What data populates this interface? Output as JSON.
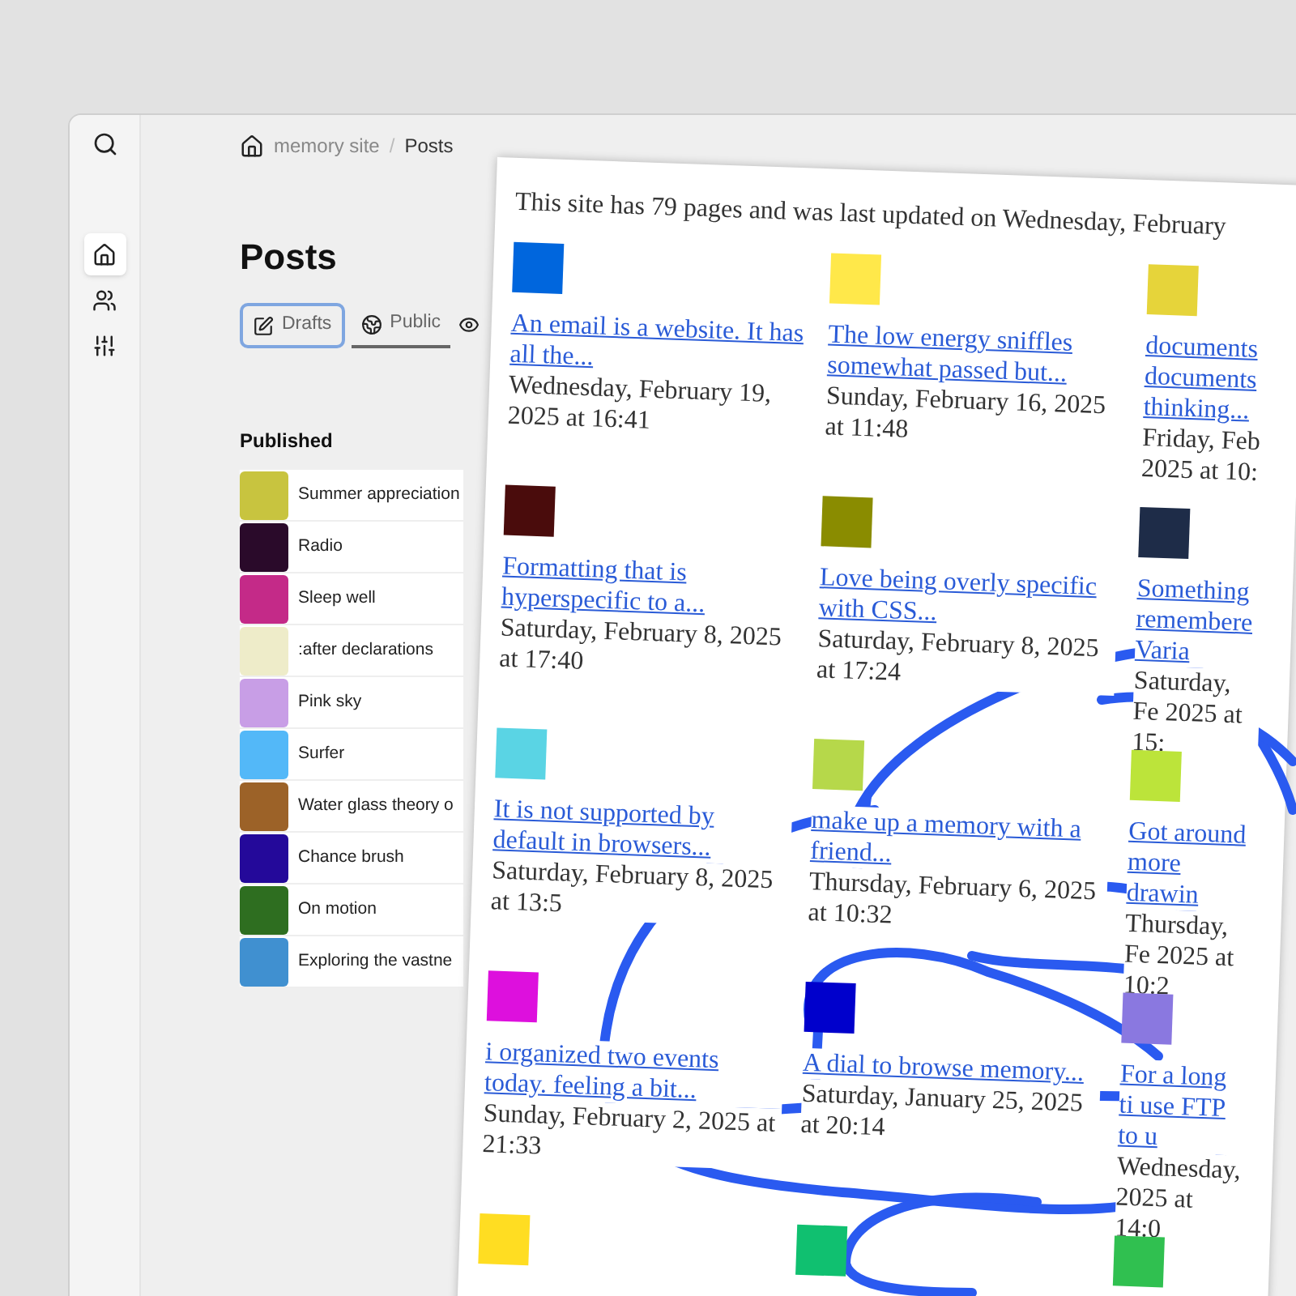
{
  "sidebar": {
    "items": [
      {
        "selected": true
      },
      {
        "selected": false
      },
      {
        "selected": false
      }
    ]
  },
  "breadcrumb": {
    "items": [
      "memory site",
      "Posts"
    ],
    "separator": "/"
  },
  "heading": "Posts",
  "tabs": [
    {
      "label": "Drafts",
      "selected": false,
      "focused": true
    },
    {
      "label": "Public",
      "selected": true,
      "focused": false
    },
    {
      "selected": false,
      "focused": false
    }
  ],
  "published": {
    "title": "Published",
    "items": [
      {
        "title": "Summer appreciation",
        "color": "#c8c43f"
      },
      {
        "title": "Radio",
        "color": "#2a0a2a"
      },
      {
        "title": "Sleep well",
        "color": "#c42a88"
      },
      {
        "title": ":after declarations",
        "color": "#eeecc9"
      },
      {
        "title": "Pink sky",
        "color": "#c89ee6"
      },
      {
        "title": "Surfer",
        "color": "#53b8f8"
      },
      {
        "title": "Water glass theory o",
        "color": "#9c6228"
      },
      {
        "title": "Chance brush",
        "color": "#24099a"
      },
      {
        "title": "On motion",
        "color": "#2e6e20"
      },
      {
        "title": "Exploring the vastne",
        "color": "#4090d0"
      }
    ]
  },
  "preview": {
    "summary": "This site has 79 pages and was last updated on Wednesday, February",
    "cards": [
      {
        "color": "#0066dd",
        "title": "An email is a website. It has all the...",
        "date": "Wednesday, February 19, 2025 at 16:41"
      },
      {
        "color": "#ffe84a",
        "title": "The low energy sniffles somewhat passed but...",
        "date": "Sunday, February 16, 2025 at 11:48"
      },
      {
        "color": "#e6d43a",
        "title": "documents documents thinking...",
        "date": "Friday, Feb 2025 at 10:"
      },
      {
        "color": "#4a0c0c",
        "title": "Formatting that is hyperspecific to a...",
        "date": "Saturday, February 8, 2025 at 17:40"
      },
      {
        "color": "#8a8c00",
        "title": "Love being overly specific with CSS...",
        "date": "Saturday, February 8, 2025 at 17:24"
      },
      {
        "color": "#1e2c48",
        "title": "Something remembere Varia",
        "date": "Saturday, Fe 2025 at 15:"
      },
      {
        "color": "#5ad4e4",
        "title": "It is not supported by default in browsers...",
        "date": "Saturday, February 8, 2025 at 13:5"
      },
      {
        "color": "#b6d84a",
        "title": "make up a memory with a friend...",
        "date": "Thursday, February 6, 2025 at 10:32"
      },
      {
        "color": "#bce43a",
        "title": "Got around more drawin",
        "date": "Thursday, Fe 2025 at 10:2"
      },
      {
        "color": "#dd10dd",
        "title": "i organized two events today. feeling a bit...",
        "date": "Sunday, February 2, 2025 at 21:33"
      },
      {
        "color": "#0000cc",
        "title": "A dial to browse memory...",
        "date": "Saturday, January 25, 2025 at 20:14"
      },
      {
        "color": "#8a78e0",
        "title": "For a long ti use FTP to u",
        "date": "Wednesday, 2025 at 14:0"
      },
      {
        "color": "#ffdd22"
      },
      {
        "color": "#10c070"
      },
      {
        "color": "#30c050"
      }
    ]
  }
}
